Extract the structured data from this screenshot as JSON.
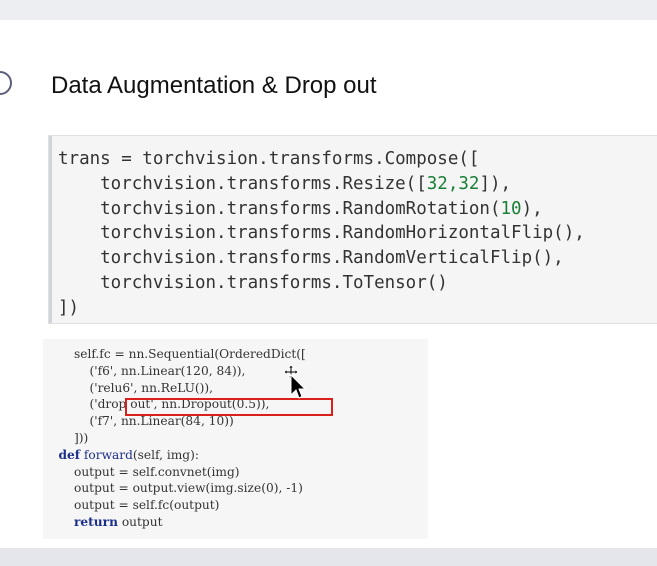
{
  "section": {
    "title": "Data Augmentation & Drop out"
  },
  "code_cell": {
    "lines": [
      [
        "trans = torchvision.transforms.Compose([",
        ""
      ],
      [
        "    torchvision.transforms.Resize([",
        "32,32",
        "]),"
      ],
      [
        "    torchvision.transforms.RandomRotation(",
        "10",
        "),"
      ],
      [
        "    torchvision.transforms.RandomHorizontalFlip(),",
        ""
      ],
      [
        "    torchvision.transforms.RandomVerticalFlip(),",
        ""
      ],
      [
        "    torchvision.transforms.ToTensor()",
        ""
      ],
      [
        "])",
        ""
      ]
    ],
    "line1": "trans = torchvision.transforms.Compose([",
    "line2_a": "    torchvision.transforms.Resize([",
    "line2_n": "32,32",
    "line2_b": "]),",
    "line3_a": "    torchvision.transforms.RandomRotation(",
    "line3_n": "10",
    "line3_b": "),",
    "line4": "    torchvision.transforms.RandomHorizontalFlip(),",
    "line5": "    torchvision.transforms.RandomVerticalFlip(),",
    "line6": "    torchvision.transforms.ToTensor()",
    "line7": "])"
  },
  "screenshot_code": {
    "l1": "        self.fc = nn.Sequential(OrderedDict([",
    "l2": "            ('f6', nn.Linear(120, 84)),",
    "l3": "            ('relu6', nn.ReLU()),",
    "l4": "            ('drop out', nn.Dropout(0.5)),",
    "l5": "            ('f7', nn.Linear(84, 10))",
    "l6": "        ]))",
    "l7_kw": "def",
    "l7_fn": "forward",
    "l7_rest": "(self, img):",
    "l8": "        output = self.convnet(img)",
    "l9": "        output = output.view(img.size(0), -1)",
    "l10": "        output = self.fc(output)",
    "l11_kw": "return",
    "l11_rest": " output"
  },
  "colors": {
    "number": "#1a7f37",
    "keyword": "#1b2f8a",
    "highlight_box": "#d9201b"
  },
  "icons": [
    "section-marker-icon",
    "move-cursor-icon"
  ]
}
